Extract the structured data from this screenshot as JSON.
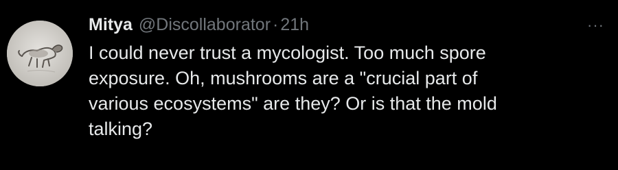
{
  "tweet": {
    "author_name": "Mitya",
    "handle": "@Discollaborator",
    "separator": "·",
    "time": "21h",
    "more_icon": "more-horizontal-icon",
    "more_glyph": "···",
    "text": "I could never trust a mycologist. Too much spore\nexposure. Oh, mushrooms are a \"crucial part of\nvarious ecosystems\" are they? Or is that the mold\ntalking?"
  },
  "colors": {
    "background": "#000000",
    "primary_text": "#e7e9ea",
    "secondary_text": "#71767b"
  }
}
